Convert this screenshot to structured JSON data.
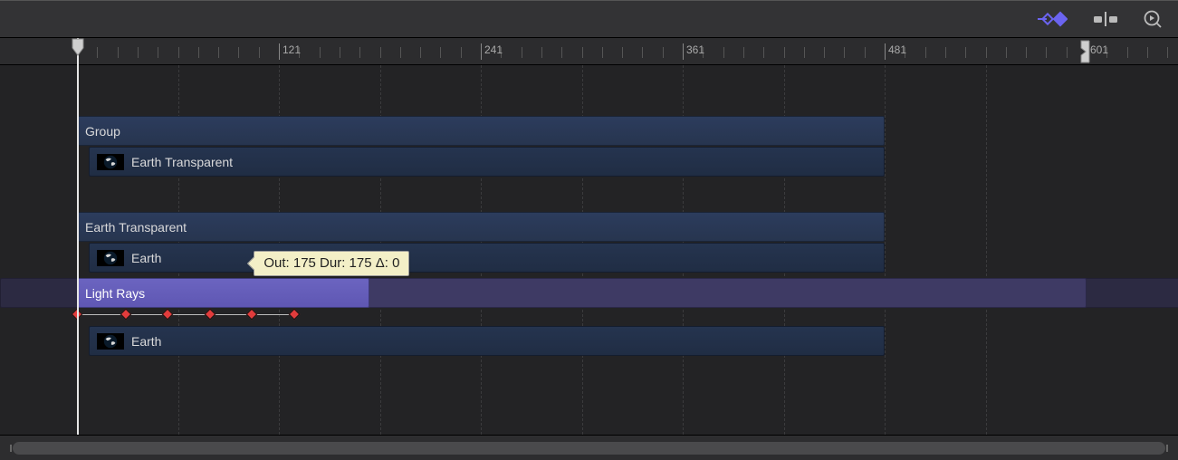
{
  "colors": {
    "accent_purple": "#6b64c0",
    "track_blue": "#25344f",
    "track_header": "#2c3c5d",
    "tooltip_bg": "#f3efc7",
    "keyframe": "#e23c3c"
  },
  "ruler": {
    "start_frame": 1,
    "majors": [
      {
        "frame": 1,
        "label": ""
      },
      {
        "frame": 121,
        "label": "121"
      },
      {
        "frame": 241,
        "label": "241"
      },
      {
        "frame": 361,
        "label": "361"
      },
      {
        "frame": 481,
        "label": "481"
      },
      {
        "frame": 601,
        "label": "601"
      }
    ],
    "playhead_frame": 1,
    "play_range_out_frame": 600
  },
  "tooltip": {
    "out": 175,
    "dur": 175,
    "delta": 0,
    "text": "Out: 175 Dur: 175 Δ: 0"
  },
  "tracks": {
    "group": {
      "label": "Group",
      "start": 1,
      "end": 481
    },
    "clip1": {
      "label": "Earth Transparent",
      "start": 1,
      "end": 481,
      "thumb": "earth"
    },
    "header2": {
      "label": "Earth Transparent",
      "start": 1,
      "end": 481
    },
    "clip2": {
      "label": "Earth",
      "start": 1,
      "end": 481,
      "thumb": "earth"
    },
    "effect": {
      "label": "Light Rays",
      "start": 1,
      "drag_end": 175,
      "full_end": 601,
      "bg_end": 720,
      "keyframes": [
        1,
        30,
        55,
        80,
        105,
        130
      ]
    },
    "clip3": {
      "label": "Earth",
      "start": 1,
      "end": 481,
      "thumb": "earth"
    }
  },
  "toolbar": {
    "keyframe_btn": "show-keyframes-button",
    "snap_btn": "snapping-button",
    "zoom_btn": "zoom-search-button"
  }
}
